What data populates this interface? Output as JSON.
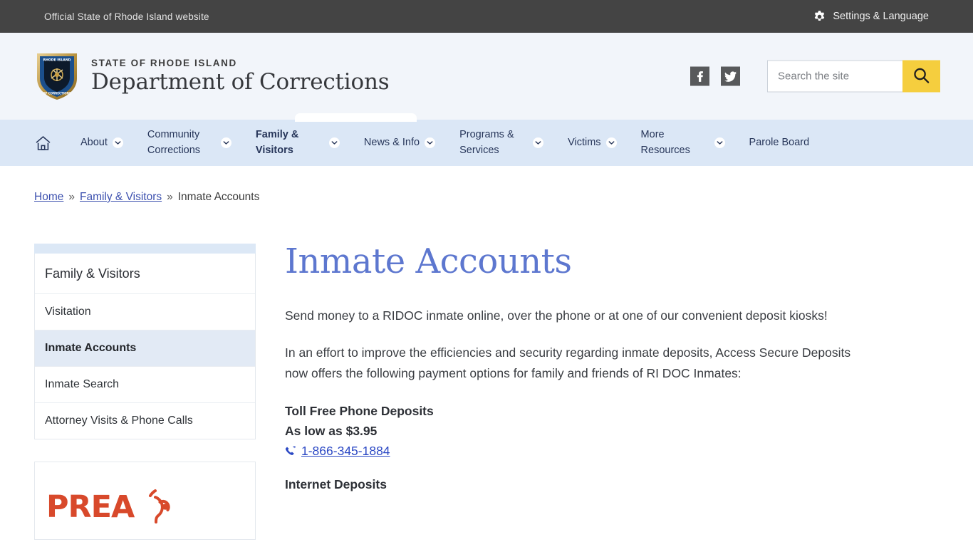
{
  "topbar": {
    "official_text": "Official State of Rhode Island website",
    "settings_label": "Settings & Language",
    "gear_icon": "gear-icon"
  },
  "masthead": {
    "logo_alt": "rhode-island-doc-shield-logo",
    "state_line": "STATE OF RHODE ISLAND",
    "department": "Department of Corrections",
    "social": [
      {
        "name": "facebook-icon",
        "glyph": "f"
      },
      {
        "name": "twitter-icon",
        "glyph": "twitter"
      }
    ],
    "search": {
      "placeholder": "Search the site",
      "value": "",
      "button_icon": "search-icon",
      "button_color": "#f5ce3e"
    }
  },
  "nav": {
    "home_icon": "home-icon",
    "items": [
      {
        "label": "About",
        "has_dropdown": true,
        "active": false
      },
      {
        "label": "Community Corrections",
        "has_dropdown": true,
        "active": false
      },
      {
        "label": "Family & Visitors",
        "has_dropdown": true,
        "active": true
      },
      {
        "label": "News & Info",
        "has_dropdown": true,
        "active": false
      },
      {
        "label": "Programs & Services",
        "has_dropdown": true,
        "active": false
      },
      {
        "label": "Victims",
        "has_dropdown": true,
        "active": false
      },
      {
        "label": "More Resources",
        "has_dropdown": true,
        "active": false
      },
      {
        "label": "Parole Board",
        "has_dropdown": false,
        "active": false
      }
    ]
  },
  "breadcrumb": {
    "separator": "»",
    "items": [
      {
        "label": "Home",
        "link": true
      },
      {
        "label": "Family & Visitors",
        "link": true
      },
      {
        "label": "Inmate Accounts",
        "link": false
      }
    ]
  },
  "sidebar": {
    "heading": "Family & Visitors",
    "items": [
      {
        "label": "Visitation",
        "current": false
      },
      {
        "label": "Inmate Accounts",
        "current": true
      },
      {
        "label": "Inmate Search",
        "current": false
      },
      {
        "label": "Attorney Visits & Phone Calls",
        "current": false
      }
    ],
    "promo": {
      "name": "prea-logo",
      "word": "PREA",
      "icon": "ear-listening-icon",
      "color": "#d8492b"
    }
  },
  "main": {
    "title": "Inmate Accounts",
    "title_color": "#5d77cf",
    "paragraphs": [
      "Send money to a RIDOC inmate online, over the phone or at one of our convenient deposit kiosks!",
      "In an effort to improve the efficiencies and security regarding inmate deposits, Access Secure Deposits now offers the following payment options for family and friends of RI DOC Inmates:"
    ],
    "section": {
      "heading": "Toll Free Phone Deposits",
      "price": "As low as $3.95",
      "phone_icon": "phone-icon",
      "phone": "1-866-345-1884"
    },
    "next_heading": "Internet Deposits"
  },
  "colors": {
    "topbar_bg": "#444444",
    "masthead_bg": "#f2f5fa",
    "nav_bg": "#dbe7f6",
    "sidebar_cap": "#dce8f6",
    "sidebar_current": "#e2eaf5",
    "link": "#3b4fae"
  }
}
